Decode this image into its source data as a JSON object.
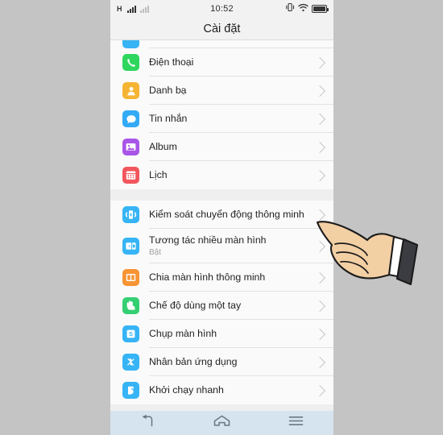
{
  "theme": {
    "outer_bg": "#c4c4c4",
    "screen_bg": "#f7f7f7",
    "list_bg": "#fafafa",
    "group_gap_bg": "#efefef",
    "navbar_bg": "#d6e4ef",
    "text": "#1f1f1f",
    "subtext": "#a0a0a0",
    "chevron": "#c6c6c6"
  },
  "statusbar": {
    "network_label": "H",
    "signal_bars": 4,
    "signal_bars_secondary": 4,
    "time": "10:52",
    "icons": [
      "vibrate-icon",
      "wifi-icon",
      "battery-icon"
    ],
    "battery_level": "100"
  },
  "header": {
    "title": "Cài đặt"
  },
  "groups": [
    {
      "name": "apps-group",
      "items": [
        {
          "label": "",
          "sub": "",
          "icon": "cut-off-app-icon",
          "color": "#36b4f5",
          "partial": true,
          "glyph": "none"
        },
        {
          "label": "Điện thoại",
          "sub": "",
          "icon": "phone-icon",
          "color": "#2fd65e",
          "glyph": "phone"
        },
        {
          "label": "Danh bạ",
          "sub": "",
          "icon": "contacts-icon",
          "color": "#f5b433",
          "glyph": "person"
        },
        {
          "label": "Tin nhắn",
          "sub": "",
          "icon": "messages-icon",
          "color": "#33aaf5",
          "glyph": "bubble"
        },
        {
          "label": "Album",
          "sub": "",
          "icon": "album-icon",
          "color": "#a855e8",
          "glyph": "photo"
        },
        {
          "label": "Lịch",
          "sub": "",
          "icon": "calendar-icon",
          "color": "#f2565c",
          "glyph": "calendar"
        }
      ]
    },
    {
      "name": "smart-features-group",
      "items": [
        {
          "label": "Kiểm soát chuyển động thông minh",
          "sub": "",
          "icon": "motion-control-icon",
          "color": "#36b4f5",
          "glyph": "phone-motion"
        },
        {
          "label": "Tương tác nhiều màn hình",
          "sub": "Bật",
          "icon": "multi-screen-interaction-icon",
          "color": "#36b4f5",
          "glyph": "multiscreen"
        },
        {
          "label": "Chia màn hình thông minh",
          "sub": "",
          "icon": "split-screen-icon",
          "color": "#f79434",
          "glyph": "split"
        },
        {
          "label": "Chế độ dùng một tay",
          "sub": "",
          "icon": "one-handed-mode-icon",
          "color": "#34cf72",
          "glyph": "hand-tap"
        },
        {
          "label": "Chụp màn hình",
          "sub": "",
          "icon": "screenshot-icon",
          "color": "#36b4f5",
          "glyph": "screenshot"
        },
        {
          "label": "Nhân bản ứng dụng",
          "sub": "",
          "icon": "app-clone-icon",
          "color": "#36b4f5",
          "glyph": "clone"
        },
        {
          "label": "Khởi chạy nhanh",
          "sub": "",
          "icon": "quick-launch-icon",
          "color": "#36b4f5",
          "glyph": "quicklaunch"
        }
      ]
    }
  ],
  "navbar": {
    "buttons": [
      {
        "name": "back-button",
        "icon": "back-arrow-icon"
      },
      {
        "name": "home-button",
        "icon": "home-icon"
      },
      {
        "name": "menu-button",
        "icon": "menu-icon"
      }
    ]
  },
  "overlay": {
    "cursor": "pointing-hand-cursor",
    "skin_color": "#f3cfa4",
    "sleeve_color": "#3b3b42",
    "cuff_color": "#ffffff"
  }
}
